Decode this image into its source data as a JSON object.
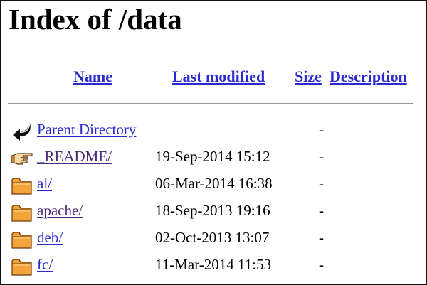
{
  "page": {
    "title": "Index of /data"
  },
  "columns": {
    "name": "Name",
    "last_modified": "Last modified",
    "size": "Size",
    "description": "Description"
  },
  "entries": [
    {
      "name": "Parent Directory",
      "modified": "",
      "size": "-",
      "icon": "back-arrow-icon"
    },
    {
      "name": "_README/",
      "modified": "19-Sep-2014 15:12",
      "size": "-",
      "icon": "pointing-hand-icon"
    },
    {
      "name": "al/",
      "modified": "06-Mar-2014 16:38",
      "size": "-",
      "icon": "folder-icon"
    },
    {
      "name": "apache/",
      "modified": "18-Sep-2013 19:16",
      "size": "-",
      "icon": "folder-icon"
    },
    {
      "name": "deb/",
      "modified": "02-Oct-2013 13:07",
      "size": "-",
      "icon": "folder-icon"
    },
    {
      "name": "fc/",
      "modified": "11-Mar-2014 11:53",
      "size": "-",
      "icon": "folder-icon"
    }
  ],
  "colors": {
    "link": "#2a2ad0",
    "visited_link": "#4b2a7a",
    "folder": "#f2a33a"
  }
}
